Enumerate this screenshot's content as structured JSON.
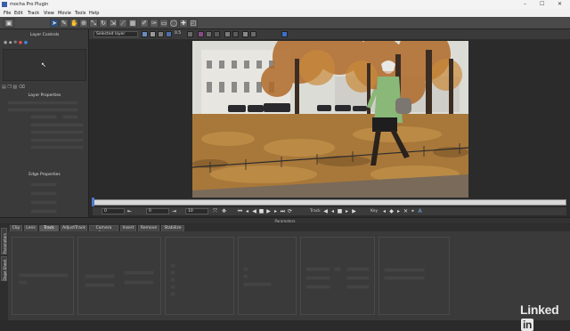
{
  "window": {
    "title": "mocha Pro Plugin",
    "minimize_glyph": "–",
    "maximize_glyph": "☐",
    "close_glyph": "✕"
  },
  "menu": {
    "items": [
      "File",
      "Edit",
      "Track",
      "View",
      "Movie",
      "Tools",
      "Help"
    ]
  },
  "toolbar": {
    "layer_select": "Selected layer",
    "value": "0.5"
  },
  "left_panel": {
    "layer_controls": "Layer Controls",
    "layer_properties": "Layer Properties",
    "edge_properties": "Edge Properties"
  },
  "timeline": {
    "in_frame": "0",
    "current_frame": "0",
    "out_frame": "10",
    "track_label": "Track",
    "key_label": "Key"
  },
  "params_label": "Parameters",
  "tabs": [
    "Clip",
    "Lens",
    "Track",
    "AdjustTrack",
    "Camera Solve",
    "Insert",
    "Remove",
    "Stabilize"
  ],
  "active_tab": "Track",
  "side_tabs": [
    "Parameters",
    "Dope Sheet"
  ],
  "watermark": {
    "text": "Linked",
    "badge": "in"
  },
  "colors": {
    "accent": "#2d4f7c",
    "panel": "#3a3a3a",
    "bg": "#2b2b2b"
  }
}
